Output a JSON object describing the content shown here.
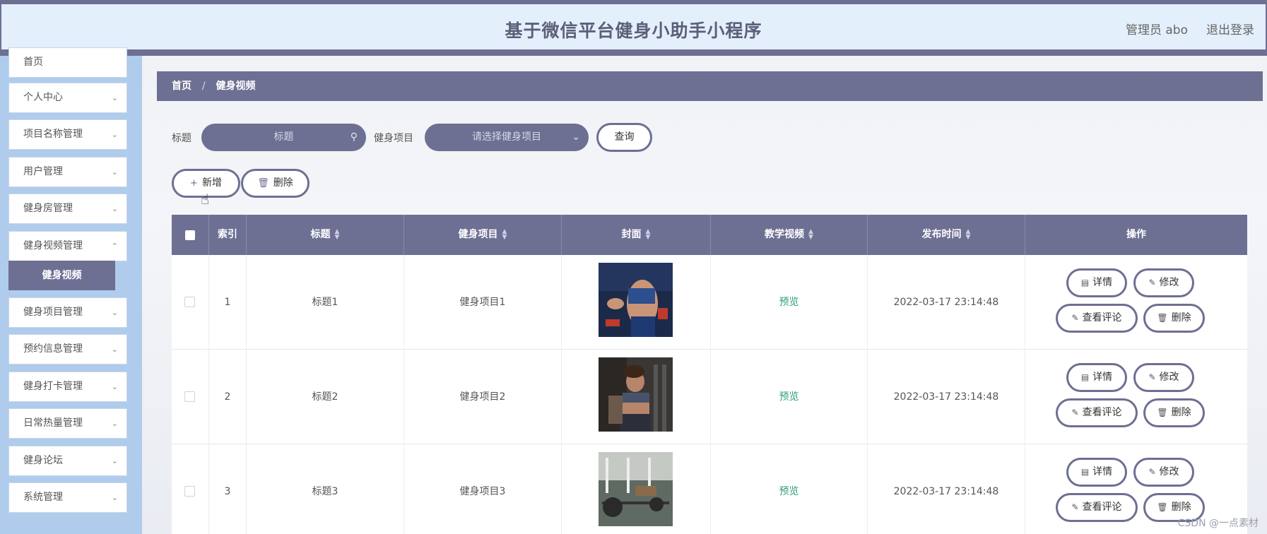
{
  "header": {
    "title": "基于微信平台健身小助手小程序",
    "user": "管理员 abo",
    "logout": "退出登录"
  },
  "sidebar": {
    "items": [
      {
        "label": "首页"
      },
      {
        "label": "个人中心"
      },
      {
        "label": "项目名称管理"
      },
      {
        "label": "用户管理"
      },
      {
        "label": "健身房管理"
      },
      {
        "label": "健身视频管理"
      },
      {
        "label": "健身项目管理"
      },
      {
        "label": "预约信息管理"
      },
      {
        "label": "健身打卡管理"
      },
      {
        "label": "日常热量管理"
      },
      {
        "label": "健身论坛"
      },
      {
        "label": "系统管理"
      }
    ],
    "active_sub": "健身视频"
  },
  "breadcrumb": {
    "home": "首页",
    "sep": "/",
    "current": "健身视频"
  },
  "search": {
    "title_label": "标题",
    "title_placeholder": "标题",
    "project_label": "健身项目",
    "project_placeholder": "请选择健身项目",
    "query_button": "查询"
  },
  "toolbar": {
    "add": "新增",
    "delete": "删除"
  },
  "table": {
    "columns": [
      "索引",
      "标题",
      "健身项目",
      "封面",
      "教学视频",
      "发布时间",
      "操作"
    ],
    "rows": [
      {
        "index": "1",
        "title": "标题1",
        "project": "健身项目1",
        "video": "预览",
        "time": "2022-03-17 23:14:48"
      },
      {
        "index": "2",
        "title": "标题2",
        "project": "健身项目2",
        "video": "预览",
        "time": "2022-03-17 23:14:48"
      },
      {
        "index": "3",
        "title": "标题3",
        "project": "健身项目3",
        "video": "预览",
        "time": "2022-03-17 23:14:48"
      }
    ],
    "actions": {
      "detail": "详情",
      "edit": "修改",
      "comments": "查看评论",
      "delete": "删除"
    }
  },
  "watermark": "CSDN @一点素材",
  "colors": {
    "accent": "#6d6f93",
    "sidebar": "#b0ccec",
    "header": "#e3f0fb",
    "preview": "#2f9e74"
  }
}
